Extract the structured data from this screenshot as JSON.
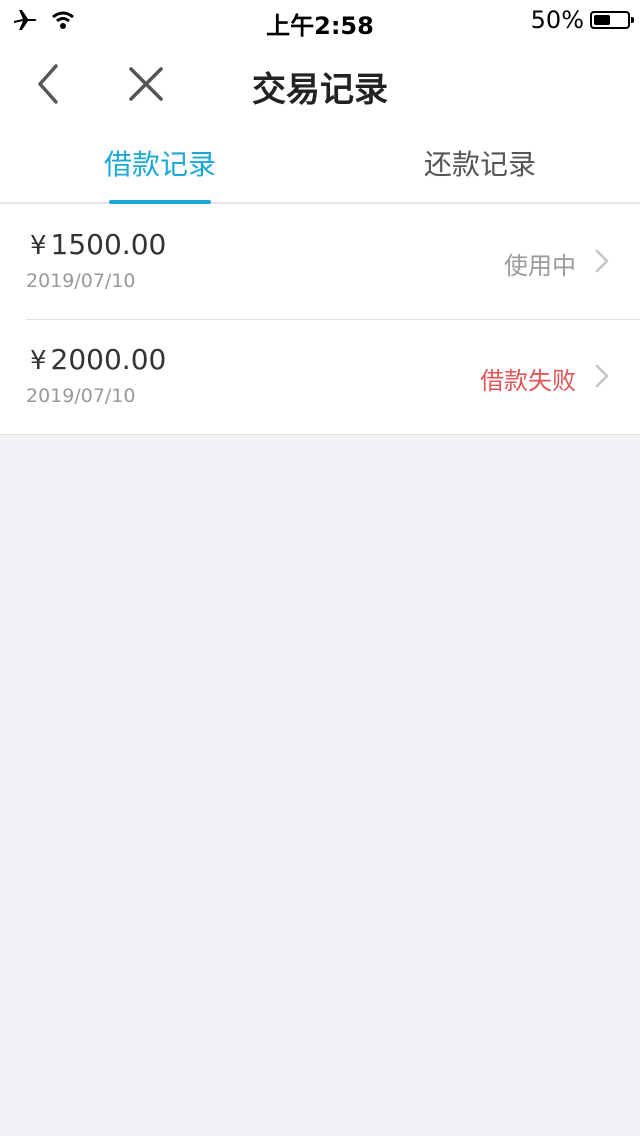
{
  "status_bar": {
    "time": "上午2:58",
    "battery": "50%",
    "battery_level": 0.5
  },
  "nav": {
    "title": "交易记录",
    "back_icon": "chevron-left-icon",
    "close_icon": "close-icon"
  },
  "tabs": [
    {
      "label": "借款记录",
      "active": true
    },
    {
      "label": "还款记录",
      "active": false
    }
  ],
  "records": [
    {
      "currency": "¥",
      "amount": "1500.00",
      "date": "2019/07/10",
      "status": "使用中",
      "status_color": "#9a9a9a"
    },
    {
      "currency": "¥",
      "amount": "2000.00",
      "date": "2019/07/10",
      "status": "借款失败",
      "status_color": "#e05555"
    }
  ],
  "colors": {
    "accent": "#1aa9d6",
    "background": "#f2f2f6",
    "error": "#e05555"
  }
}
